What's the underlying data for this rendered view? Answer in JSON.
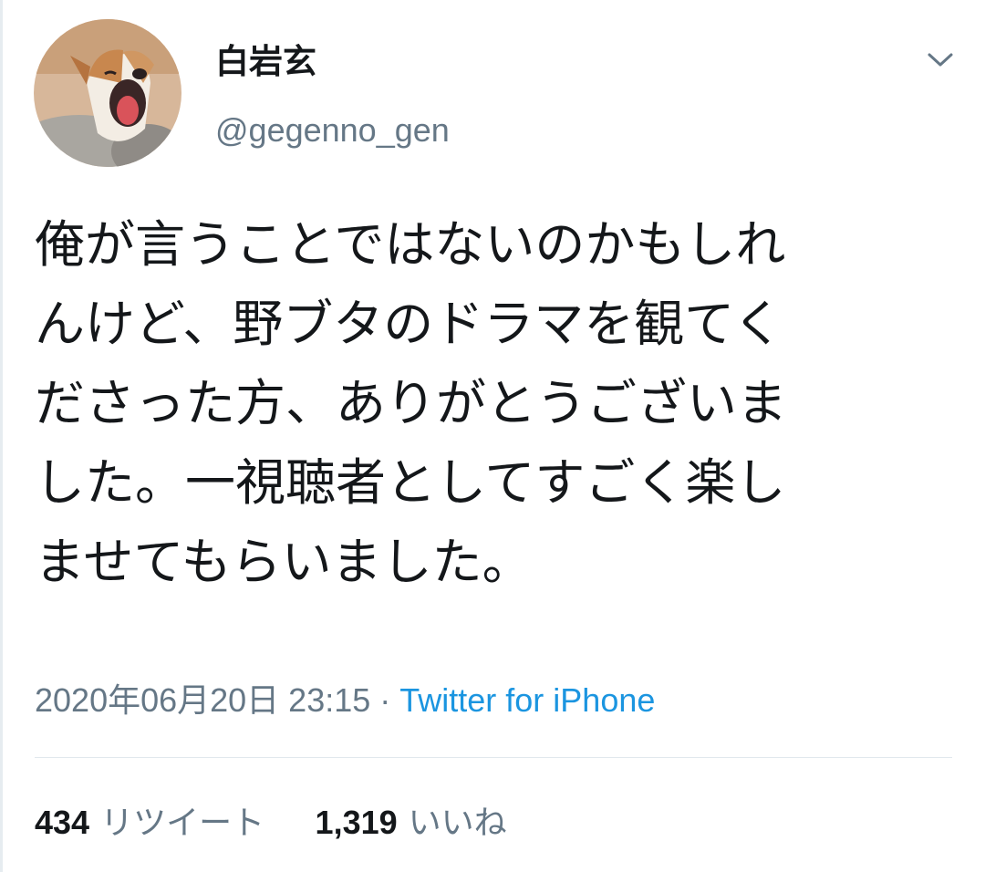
{
  "tweet": {
    "author": {
      "display_name": "白岩玄",
      "handle": "@gegenno_gen",
      "avatar_icon": "avatar-yawning-dog"
    },
    "menu_icon": "chevron-down-icon",
    "text": "俺が言うことではないのかもしれ\nんけど、野ブタのドラマを観てく\nださった方、ありがとうございま\nした。一視聴者としてすごく楽し\nませてもらいました。",
    "timestamp": "2020年06月20日 23:15",
    "separator": " · ",
    "source": "Twitter for iPhone",
    "stats": {
      "retweets_count": "434",
      "retweets_label": "リツイート",
      "likes_count": "1,319",
      "likes_label": "いいね"
    }
  },
  "colors": {
    "text_primary": "#14171a",
    "text_secondary": "#657786",
    "link": "#1b95e0",
    "divider": "#e1e8ed"
  }
}
